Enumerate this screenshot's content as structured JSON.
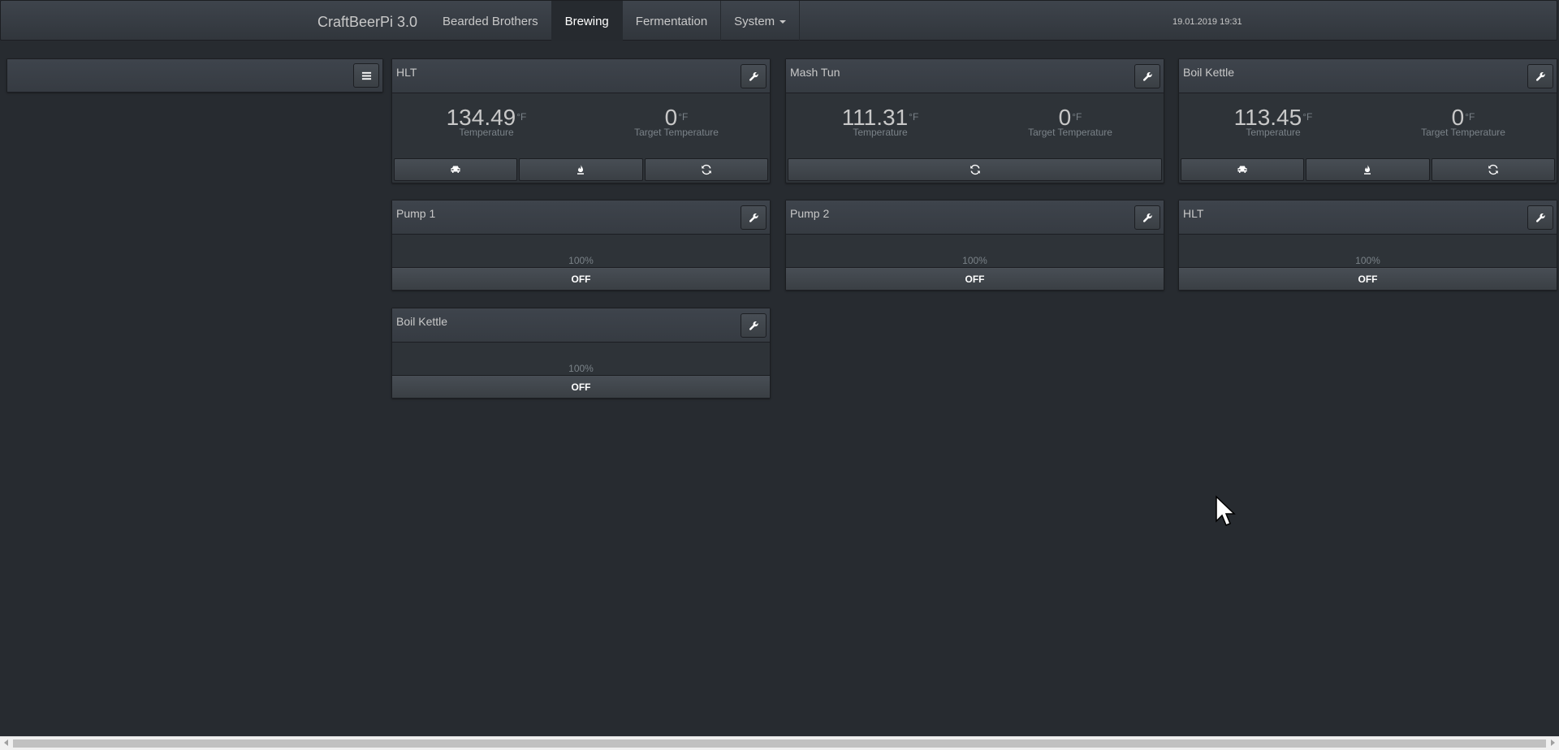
{
  "navbar": {
    "brand": "CraftBeerPi 3.0",
    "items": [
      {
        "label": "Bearded Brothers",
        "active": false
      },
      {
        "label": "Brewing",
        "active": true
      },
      {
        "label": "Fermentation",
        "active": false
      },
      {
        "label": "System",
        "active": false,
        "dropdown": true
      }
    ],
    "datetime": "19.01.2019 19:31"
  },
  "sidebar": {
    "menu_icon": "list-icon"
  },
  "kettles": [
    {
      "name": "HLT",
      "temperature": "134.49",
      "temperature_unit": "°F",
      "temperature_label": "Temperature",
      "target": "0",
      "target_unit": "°F",
      "target_label": "Target Temperature",
      "buttons": [
        "car-icon",
        "fire-icon",
        "refresh-icon"
      ]
    },
    {
      "name": "Mash Tun",
      "temperature": "111.31",
      "temperature_unit": "°F",
      "temperature_label": "Temperature",
      "target": "0",
      "target_unit": "°F",
      "target_label": "Target Temperature",
      "buttons": [
        "refresh-icon"
      ]
    },
    {
      "name": "Boil Kettle",
      "temperature": "113.45",
      "temperature_unit": "°F",
      "temperature_label": "Temperature",
      "target": "0",
      "target_unit": "°F",
      "target_label": "Target Temperature",
      "buttons": [
        "car-icon",
        "fire-icon",
        "refresh-icon"
      ]
    }
  ],
  "actors": [
    {
      "name": "Pump 1",
      "power": "100%",
      "state": "OFF"
    },
    {
      "name": "Pump 2",
      "power": "100%",
      "state": "OFF"
    },
    {
      "name": "HLT",
      "power": "100%",
      "state": "OFF"
    },
    {
      "name": "Boil Kettle",
      "power": "100%",
      "state": "OFF"
    }
  ],
  "colors": {
    "background": "#272b30",
    "panel": "#2e3338",
    "text": "#c8c8c8",
    "muted": "#7a8288"
  }
}
